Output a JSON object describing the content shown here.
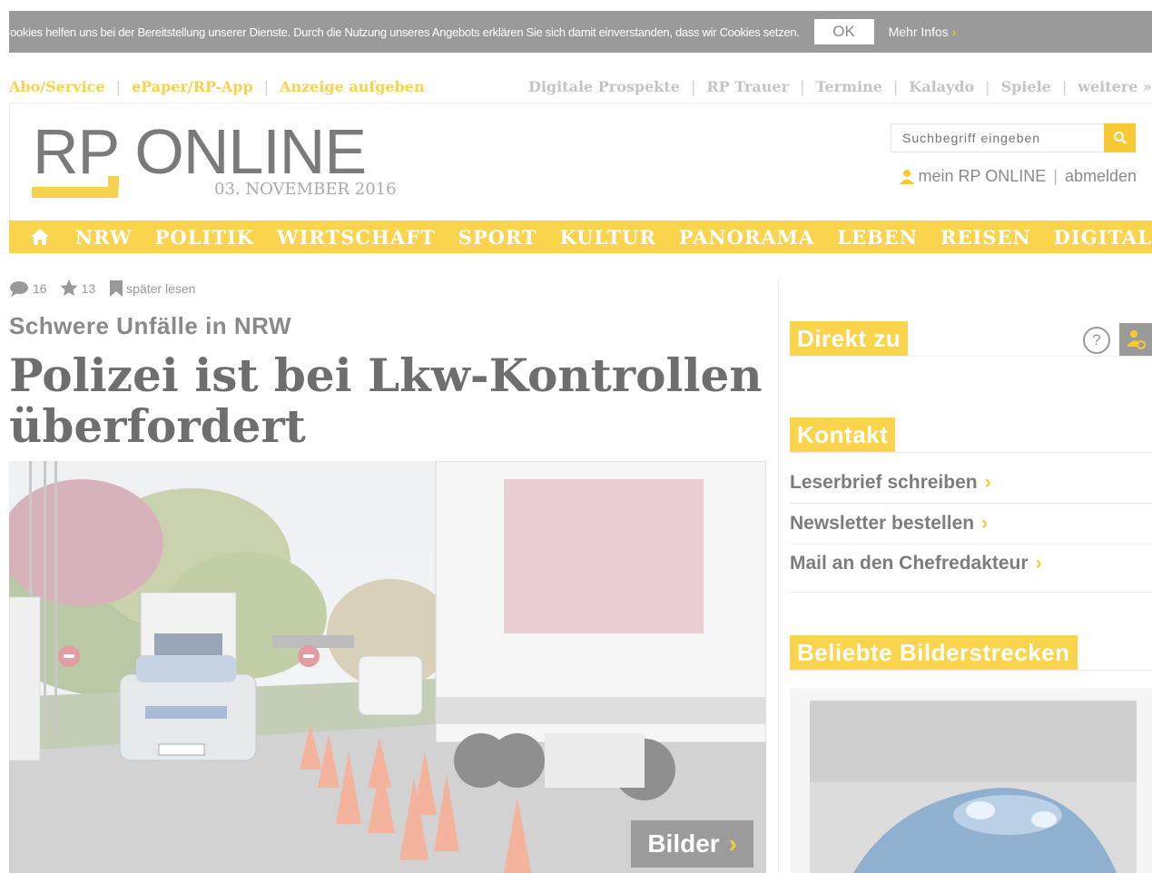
{
  "cookie": {
    "text": "Cookies helfen uns bei der Bereitstellung unserer Dienste. Durch die Nutzung unseres Angebots erklären Sie sich damit einverstanden, dass wir Cookies setzen.",
    "ok_label": "OK",
    "more_label": "Mehr Infos",
    "chevron": "›"
  },
  "service_links": {
    "left": [
      "Abo/Service",
      "ePaper/RP-App",
      "Anzeige aufgeben"
    ],
    "right": [
      "Digitale Prospekte",
      "RP Trauer",
      "Termine",
      "Kalaydo",
      "Spiele",
      "weitere »"
    ]
  },
  "header": {
    "logo": "RP ONLINE",
    "date": "03. NOVEMBER 2016",
    "search_placeholder": "Suchbegriff eingeben",
    "account_label": "mein RP ONLINE",
    "logout_label": "abmelden"
  },
  "nav": {
    "items": [
      "NRW",
      "POLITIK",
      "WIRTSCHAFT",
      "SPORT",
      "KULTUR",
      "PANORAMA",
      "LEBEN",
      "REISEN",
      "DIGITAL"
    ]
  },
  "article": {
    "comments_count": "16",
    "stars_count": "13",
    "read_later": "später lesen",
    "kicker": "Schwere Unfälle in NRW",
    "headline": "Polizei ist bei Lkw-Kontrollen überfordert",
    "gallery_button": "Bilder",
    "chevron": "›"
  },
  "sidebar": {
    "direkt_title": "Direkt zu",
    "help_symbol": "?",
    "kontakt_title": "Kontakt",
    "contact_links": [
      "Leserbrief schreiben",
      "Newsletter bestellen",
      "Mail an den Chefredakteur"
    ],
    "chevron": "›",
    "gallery_title": "Beliebte Bilderstrecken"
  },
  "colors": {
    "accent": "#f9d44c",
    "cookie_bg": "#9a9a9a",
    "text_gray": "#8a8a8a"
  },
  "icons": [
    "comment-icon",
    "star-icon",
    "bookmark-icon",
    "home-icon",
    "search-icon",
    "user-icon",
    "help-icon",
    "personalize-icon"
  ]
}
